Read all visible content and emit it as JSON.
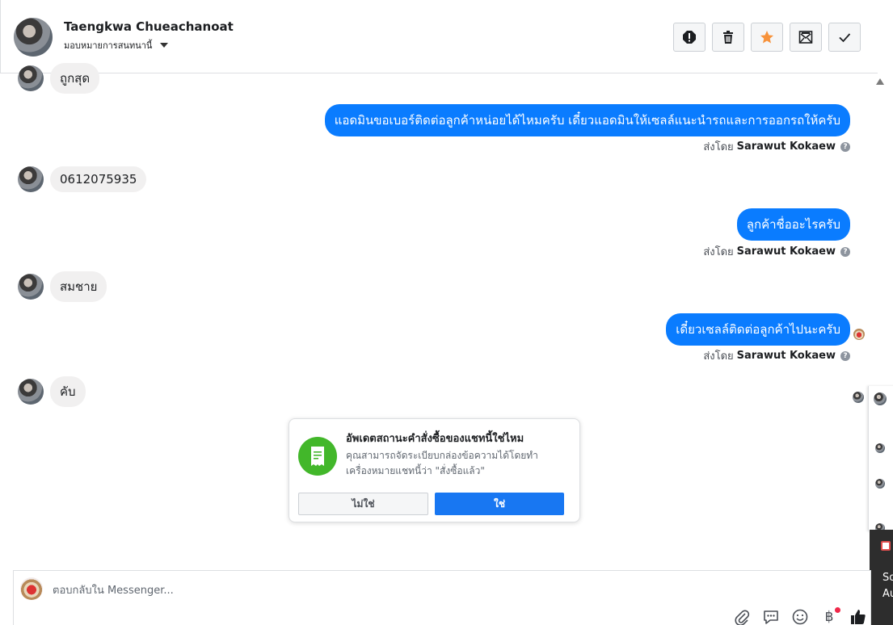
{
  "header": {
    "name": "Taengkwa Chueachanoat",
    "assign_label": "มอบหมายการสนทนานี้",
    "actions": [
      "spam-icon",
      "trash-icon",
      "star-icon",
      "mark-unread-icon",
      "done-icon"
    ]
  },
  "messages": {
    "in_1": "ถูกสุด",
    "out_1": "แอดมินขอเบอร์ติดต่อลูกค้าหน่อยได้ไหมครับ เดี๋ยวแอดมินให้เซลล์แนะนำรถและการออกรถให้ครับ",
    "in_2": "0612075935",
    "out_2": "ลูกค้าชื่ออะไรครับ",
    "in_3": "สมชาย",
    "out_3": "เดี๋ยวเซลล์ติดต่อลูกค้าไปนะครับ",
    "in_4": "คับ",
    "sent_by_prefix": "ส่งโดย",
    "sent_by_name": "Sarawut Kokaew"
  },
  "prompt": {
    "title": "อัพเดตสถานะคำสั่งซื้อของแชทนี้ใช่ไหม",
    "desc": "คุณสามารถจัดระเบียบกล่องข้อความได้โดยทำเครื่องหมายแชทนี้ว่า \"สั่งซื้อแล้ว\"",
    "no_label": "ไม่ใช่",
    "yes_label": "ใช่"
  },
  "composer": {
    "placeholder": "ตอบกลับใน Messenger...",
    "currency_symbol": "฿"
  },
  "side": {
    "text1": "So",
    "text2": "Au"
  },
  "colors": {
    "outgoing_bubble": "#0a7cff",
    "incoming_bubble": "#f1f0f0",
    "prompt_yes": "#1877f2",
    "prompt_icon": "#42b72a",
    "star": "#f7923a"
  }
}
